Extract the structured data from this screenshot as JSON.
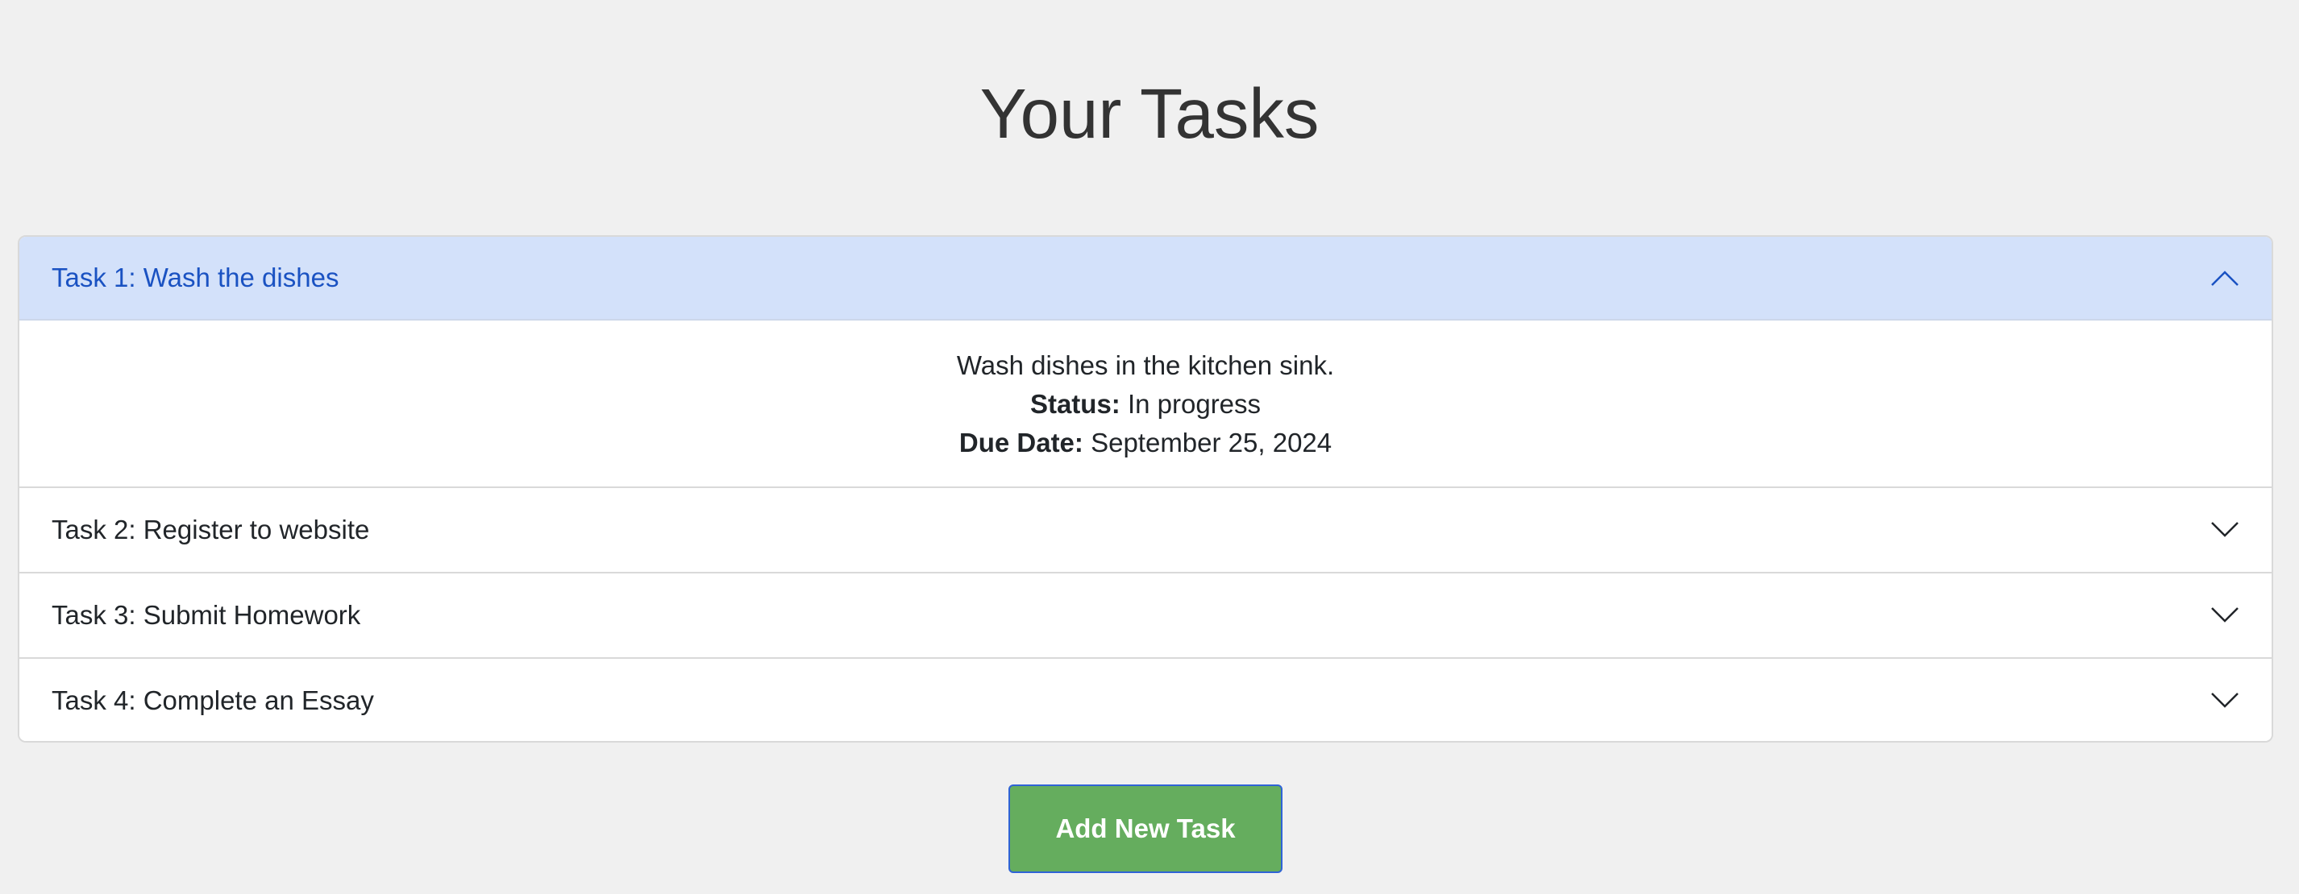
{
  "page": {
    "title": "Your Tasks"
  },
  "tasks": [
    {
      "title": "Task 1: Wash the dishes",
      "expanded": true,
      "description": "Wash dishes in the kitchen sink.",
      "status_label": "Status:",
      "status": "In progress",
      "due_label": "Due Date:",
      "due_date": "September 25, 2024"
    },
    {
      "title": "Task 2: Register to website",
      "expanded": false
    },
    {
      "title": "Task 3: Submit Homework",
      "expanded": false
    },
    {
      "title": "Task 4: Complete an Essay",
      "expanded": false
    }
  ],
  "actions": {
    "add_label": "Add New Task"
  },
  "icons": {
    "expanded": "chevron-up-icon",
    "collapsed": "chevron-down-icon"
  },
  "colors": {
    "background": "#f0f0f0",
    "open_header_bg": "#d3e1fa",
    "open_header_text": "#1a52c2",
    "button_bg": "#65ad5e",
    "button_border": "#2f63d6"
  }
}
